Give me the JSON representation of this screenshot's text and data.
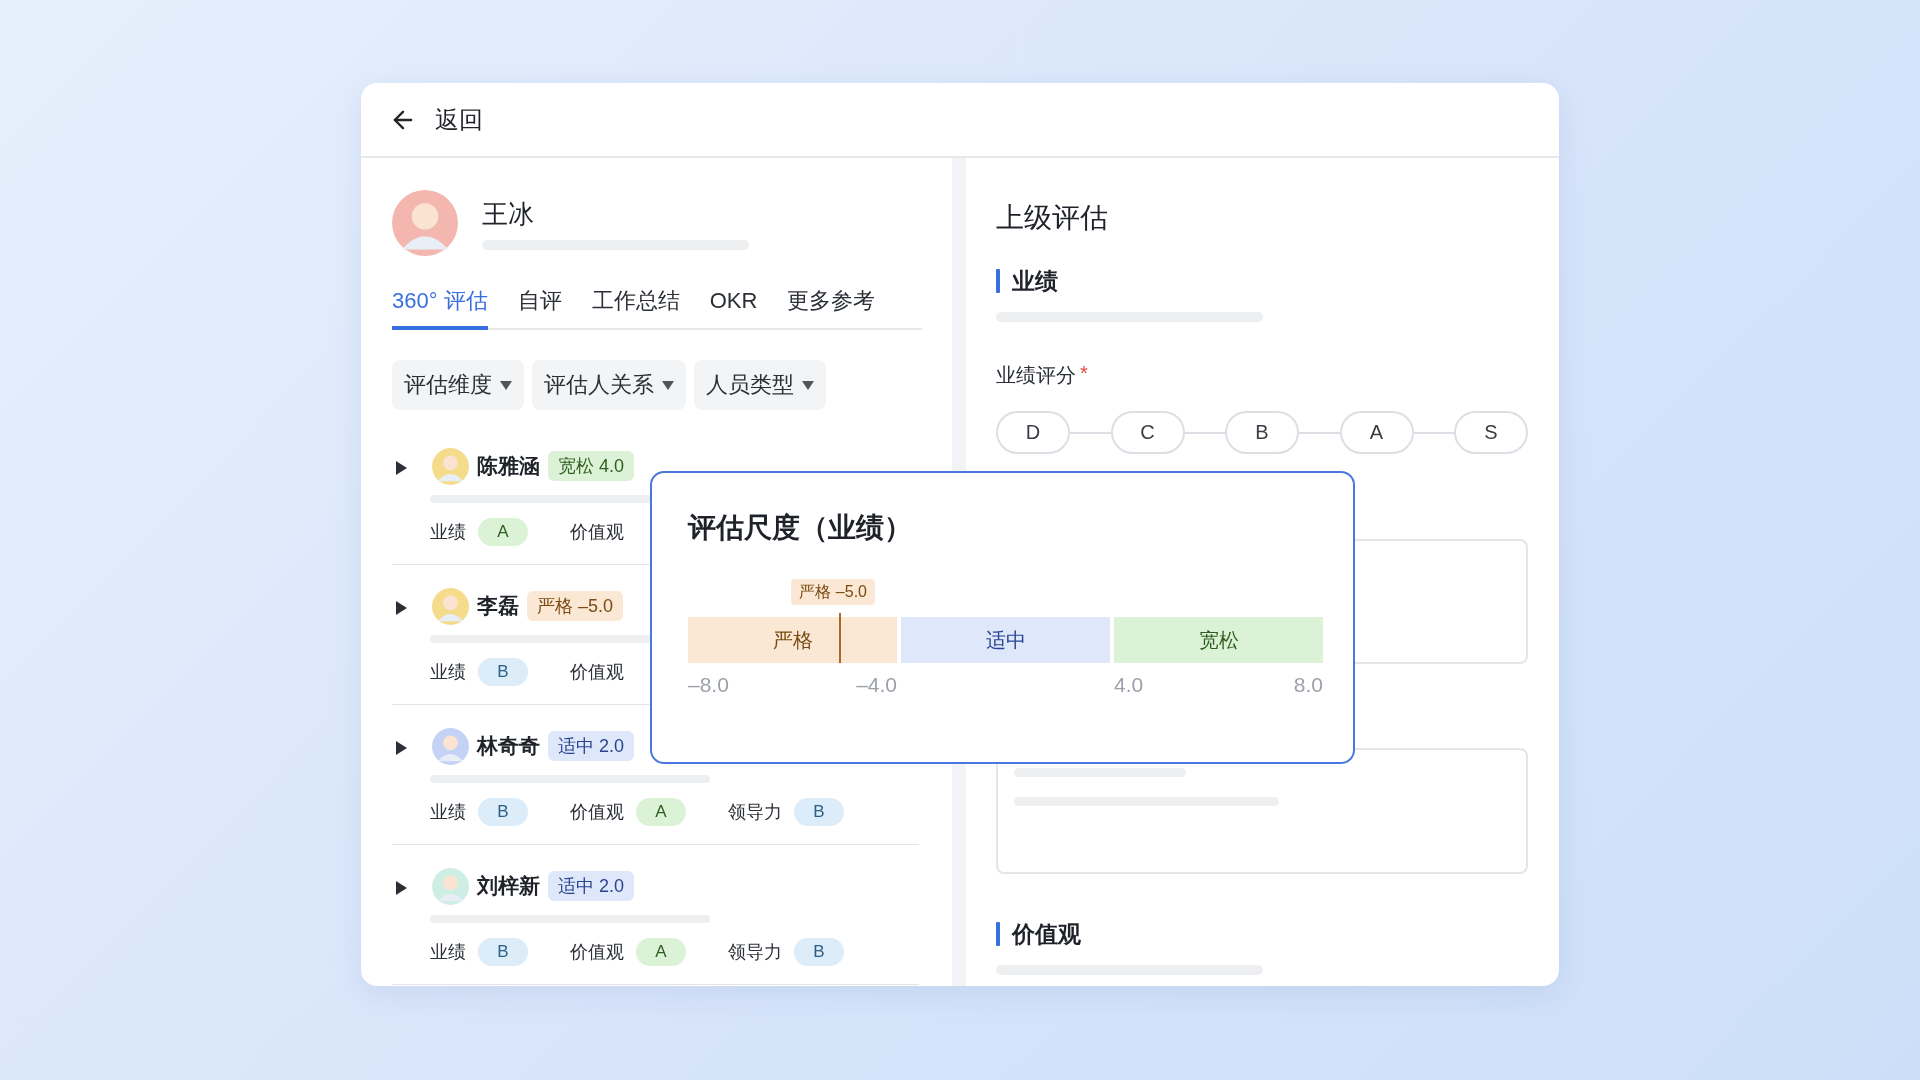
{
  "back": {
    "label": "返回"
  },
  "profile": {
    "name": "王冰"
  },
  "tabs": [
    {
      "label": "360° 评估",
      "selected": true
    },
    {
      "label": "自评",
      "selected": false
    },
    {
      "label": "工作总结",
      "selected": false
    },
    {
      "label": "OKR",
      "selected": false
    },
    {
      "label": "更多参考",
      "selected": false
    }
  ],
  "filters": [
    "评估维度",
    "评估人关系",
    "人员类型"
  ],
  "people": [
    {
      "name": "陈雅涵",
      "expanded": false,
      "tag": {
        "label": "宽松 4.0",
        "color": "#dcf2d6"
      },
      "ratings": [
        {
          "label": "业绩",
          "grade": "A",
          "color": "#dcf2d6"
        },
        {
          "label": "价值观"
        }
      ]
    },
    {
      "name": "李磊",
      "expanded": false,
      "tag": {
        "label": "严格 –5.0",
        "color": "#fbe8d4"
      },
      "ratings": [
        {
          "label": "业绩",
          "grade": "B",
          "color": "#dcecf8"
        },
        {
          "label": "价值观"
        }
      ]
    },
    {
      "name": "林奇奇",
      "expanded": false,
      "tag": {
        "label": "适中 2.0",
        "color": "#dfe8fb"
      },
      "ratings": [
        {
          "label": "业绩",
          "grade": "B",
          "color": "#dcecf8"
        },
        {
          "label": "价值观",
          "grade": "A",
          "color": "#dcf2d6"
        },
        {
          "label": "领导力",
          "grade": "B",
          "color": "#dcecf8"
        }
      ]
    },
    {
      "name": "刘梓新",
      "expanded": false,
      "tag": {
        "label": "适中 2.0",
        "color": "#dfe8fb"
      },
      "ratings": [
        {
          "label": "业绩",
          "grade": "B",
          "color": "#dcecf8"
        },
        {
          "label": "价值观",
          "grade": "A",
          "color": "#dcf2d6"
        },
        {
          "label": "领导力",
          "grade": "B",
          "color": "#dcecf8"
        }
      ]
    }
  ],
  "review": {
    "title": "上级评估",
    "performance": {
      "heading": "业绩",
      "score_label": "业绩评分",
      "required_mark": "*",
      "grades": [
        {
          "label": "D",
          "selected": false
        },
        {
          "label": "C",
          "selected": false
        },
        {
          "label": "B",
          "selected": false
        },
        {
          "label": "A",
          "selected": false
        },
        {
          "label": "S",
          "selected": false
        }
      ]
    },
    "values": {
      "heading": "价值观"
    }
  },
  "scale_popover": {
    "title": "评估尺度（业绩）",
    "bands": [
      {
        "label": "严格",
        "color": "#fbe8d4",
        "start_tick": "–8.0",
        "end_tick": "–4.0"
      },
      {
        "label": "适中",
        "color": "#dfe8fb"
      },
      {
        "label": "宽松",
        "color": "#dcf2d6",
        "start_tick": "4.0",
        "end_tick": "8.0"
      }
    ],
    "marker": {
      "label": "严格 –5.0",
      "level": 0.24,
      "color": "#fbe8d4"
    }
  }
}
